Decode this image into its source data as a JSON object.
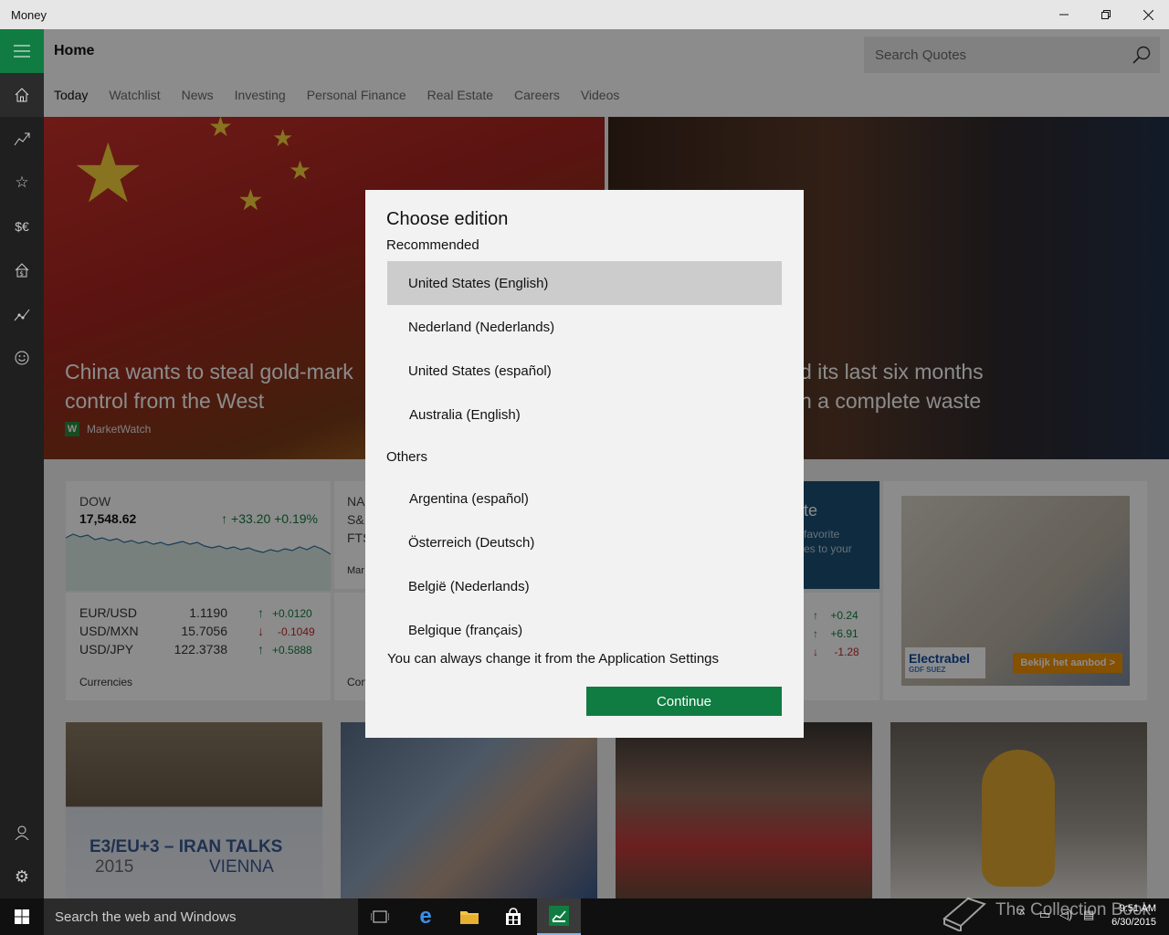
{
  "window": {
    "title": "Money",
    "minimize_icon": "minimize-icon",
    "restore_icon": "restore-icon",
    "close_icon": "close-icon"
  },
  "rail": {
    "items": [
      {
        "name": "hamburger-icon"
      },
      {
        "name": "home-icon"
      },
      {
        "name": "chart-trend-icon"
      },
      {
        "name": "star-icon"
      },
      {
        "name": "currency-icon",
        "glyph": "$€"
      },
      {
        "name": "real-estate-icon"
      },
      {
        "name": "investing-icon"
      },
      {
        "name": "smiley-icon"
      }
    ],
    "bottom": [
      {
        "name": "user-icon"
      },
      {
        "name": "gear-icon"
      }
    ]
  },
  "header": {
    "title": "Home",
    "search_placeholder": "Search Quotes"
  },
  "tabs": [
    "Today",
    "Watchlist",
    "News",
    "Investing",
    "Personal Finance",
    "Real Estate",
    "Careers",
    "Videos"
  ],
  "hero": {
    "left_caption": "China wants to steal gold-mark\ncontrol from the West",
    "left_source": "MarketWatch",
    "left_source_logo": "W",
    "right_caption": "d its last six months\nn a complete waste"
  },
  "markets": {
    "dow_label": "DOW",
    "dow_value": "17,548.62",
    "dow_change": "+33.20",
    "dow_pct": "+0.19%",
    "currencies": [
      {
        "pair": "EUR/USD",
        "value": "1.1190",
        "change": "+0.0120",
        "dir": "up"
      },
      {
        "pair": "USD/MXN",
        "value": "15.7056",
        "change": "-0.1049",
        "dir": "down"
      },
      {
        "pair": "USD/JPY",
        "value": "122.3738",
        "change": "+0.5888",
        "dir": "up"
      }
    ],
    "currencies_footer": "Currencies",
    "card2_labels": [
      "NA",
      "S&",
      "FTS"
    ],
    "card2_footer": "Mar",
    "card3_footer": "Con",
    "promo_title": "te",
    "promo_text": "favorite\nes to your",
    "card4_changes": [
      {
        "change": "+0.24",
        "dir": "up"
      },
      {
        "change": "+6.91",
        "dir": "up"
      },
      {
        "change": "-1.28",
        "dir": "down"
      }
    ]
  },
  "ad": {
    "brand": "Electrabel",
    "brand_sub": "GDF SUEZ",
    "cta": "Bekijk het aanbod  >"
  },
  "tiles": {
    "iran_text_1": "E3/EU+3 – IRAN TALKS",
    "iran_text_year": "2015",
    "iran_text_2": "VIENNA"
  },
  "dialog": {
    "title": "Choose edition",
    "recommended_label": "Recommended",
    "recommended": [
      "United States (English)",
      "Nederland (Nederlands)",
      "United States (español)",
      "Australia (English)"
    ],
    "others_label": "Others",
    "others": [
      "Argentina (español)",
      "Österreich (Deutsch)",
      "België (Nederlands)",
      "Belgique (français)"
    ],
    "note": "You can always change it from the Application Settings",
    "continue_label": "Continue"
  },
  "taskbar": {
    "search_placeholder": "Search the web and Windows",
    "watermark": "The Collection Book",
    "time": "9:51 AM",
    "date": "6/30/2015"
  },
  "colors": {
    "accent": "#107c41",
    "up": "#107c41",
    "down": "#c0282d"
  }
}
